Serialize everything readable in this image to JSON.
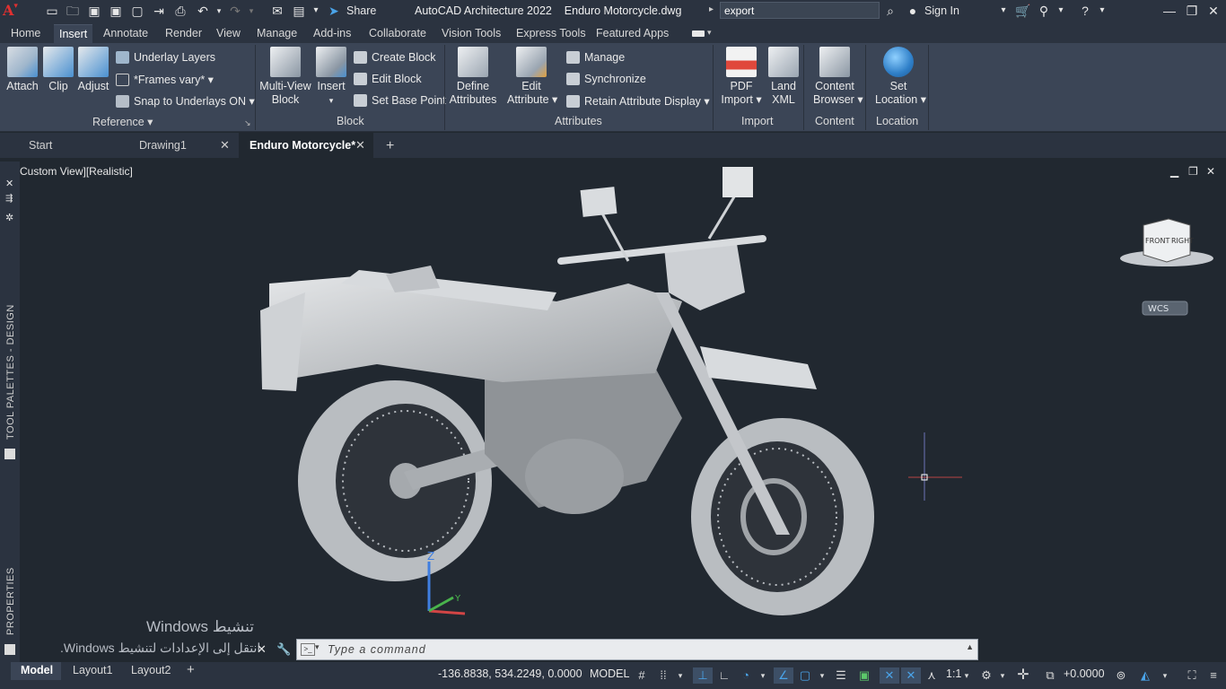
{
  "app": {
    "title": "AutoCAD Architecture 2022",
    "file": "Enduro Motorcycle.dwg",
    "logo": "A",
    "share_label": "Share",
    "search_value": "export",
    "sign_in": "Sign In"
  },
  "ribbon_tabs": [
    "Home",
    "Insert",
    "Annotate",
    "Render",
    "View",
    "Manage",
    "Add-ins",
    "Collaborate",
    "Vision Tools",
    "Express Tools",
    "Featured Apps"
  ],
  "active_tab": "Insert",
  "panels": {
    "reference": {
      "title": "Reference",
      "attach": "Attach",
      "clip": "Clip",
      "adjust": "Adjust",
      "underlay_layers": "Underlay Layers",
      "frames_vary": "*Frames vary*",
      "snap_underlays": "Snap to Underlays ON"
    },
    "block": {
      "title": "Block",
      "multi_view_1": "Multi-View",
      "multi_view_2": "Block",
      "insert": "Insert",
      "create_block": "Create Block",
      "edit_block": "Edit Block",
      "set_base_point": "Set Base Point"
    },
    "attributes": {
      "title": "Attributes",
      "define_1": "Define",
      "define_2": "Attributes",
      "edit_1": "Edit",
      "edit_2": "Attribute",
      "manage": "Manage",
      "synchronize": "Synchronize",
      "retain": "Retain Attribute Display"
    },
    "import": {
      "title": "Import",
      "pdf_1": "PDF",
      "pdf_2": "Import",
      "land_1": "Land",
      "land_2": "XML"
    },
    "content": {
      "title": "Content",
      "browser_1": "Content",
      "browser_2": "Browser"
    },
    "location": {
      "title": "Location",
      "set_1": "Set",
      "set_2": "Location"
    }
  },
  "doc_tabs": [
    "Start",
    "Drawing1",
    "Enduro Motorcycle*"
  ],
  "viewport": {
    "view_label": "[−][Custom View][Realistic]",
    "viewcube_front": "FRONT",
    "viewcube_right": "RIGHT",
    "wcs": "WCS",
    "ucs_z": "Z",
    "ucs_y": "Y"
  },
  "side_palettes": {
    "tool_palettes": "TOOL PALETTES - DESIGN",
    "properties": "PROPERTIES"
  },
  "command": {
    "placeholder": "Type a command"
  },
  "activation": {
    "line1": "Windows تنشيط",
    "line2": ".Windows انتقل إلى الإعدادات لتنشيط"
  },
  "status": {
    "layout_tabs": [
      "Model",
      "Layout1",
      "Layout2"
    ],
    "coords": "-136.8838, 534.2249, 0.0000",
    "space": "MODEL",
    "scale": "1:1",
    "offset": "+0.0000"
  },
  "colors": {
    "accent": "#4aa3e8",
    "ribbon_bg": "#3b4556",
    "title_bg": "#2b3340",
    "viewport_bg": "#212830"
  }
}
